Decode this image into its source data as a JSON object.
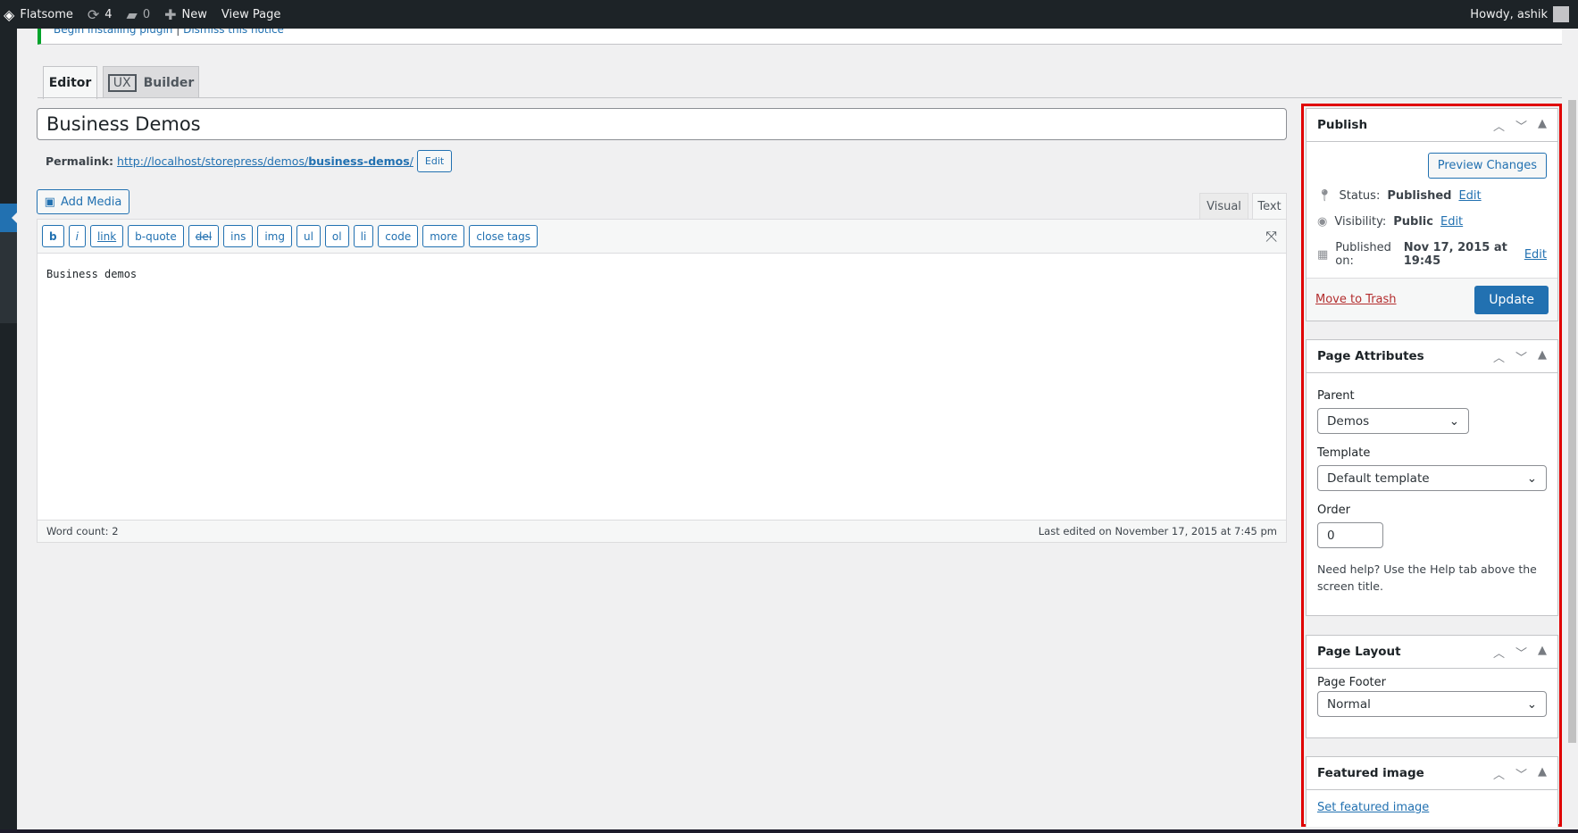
{
  "topbar": {
    "site": "Flatsome",
    "updates": "4",
    "comments": "0",
    "new": "New",
    "view": "View Page",
    "howdy": "Howdy, ashik"
  },
  "notice": {
    "link1": "Begin installing plugin",
    "sep": "|",
    "link2": "Dismiss this notice"
  },
  "tabs": {
    "editor": "Editor",
    "ux": "UX",
    "builder": "Builder"
  },
  "title": "Business Demos",
  "permalink": {
    "label": "Permalink:",
    "url_base": "http://localhost/storepress/demos/",
    "slug": "business-demos",
    "url_end": "/",
    "edit": "Edit"
  },
  "add_media": "Add Media",
  "editor_tabs": {
    "visual": "Visual",
    "text": "Text"
  },
  "toolbar": [
    "b",
    "i",
    "link",
    "b-quote",
    "del",
    "ins",
    "img",
    "ul",
    "ol",
    "li",
    "code",
    "more",
    "close tags"
  ],
  "content": "Business demos",
  "status": {
    "word_count": "Word count: 2",
    "last_edited": "Last edited on November 17, 2015 at 7:45 pm"
  },
  "publish": {
    "title": "Publish",
    "preview": "Preview Changes",
    "status_label": "Status:",
    "status": "Published",
    "visibility_label": "Visibility:",
    "visibility": "Public",
    "published_label": "Published on:",
    "published": "Nov 17, 2015 at 19:45",
    "edit": "Edit",
    "trash": "Move to Trash",
    "update": "Update"
  },
  "attributes": {
    "title": "Page Attributes",
    "parent_label": "Parent",
    "parent": "Demos",
    "template_label": "Template",
    "template": "Default template",
    "order_label": "Order",
    "order": "0",
    "help": "Need help? Use the Help tab above the screen title."
  },
  "layout": {
    "title": "Page Layout",
    "footer_label": "Page Footer",
    "footer": "Normal"
  },
  "featured": {
    "title": "Featured image",
    "link": "Set featured image"
  },
  "colors": {
    "accent": "#2271b1",
    "highlight": "#e00000",
    "adminbar": "#1d2327"
  }
}
